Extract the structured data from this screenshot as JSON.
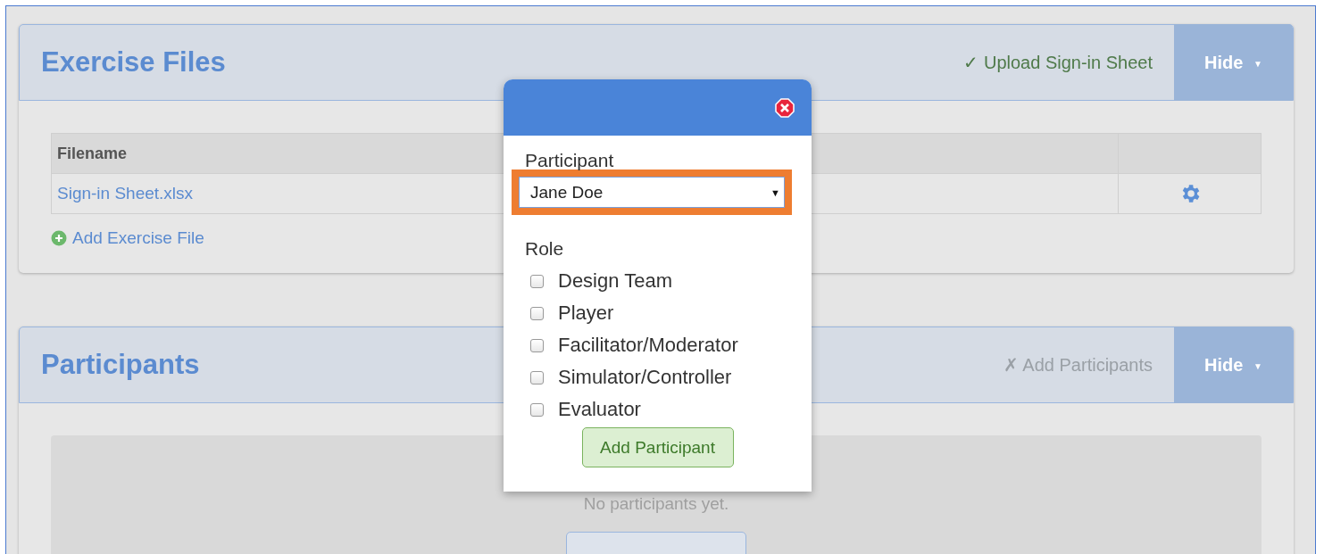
{
  "sections": [
    {
      "kind": "files",
      "title": "Exercise Files",
      "status": {
        "mark": "✓",
        "label": "Upload Sign-in Sheet",
        "done": true
      },
      "toggle": {
        "label": "Hide",
        "caret": "▼"
      },
      "table": {
        "columns": [
          "Filename"
        ],
        "rows": [
          {
            "filename": "Sign-in Sheet.xlsx"
          }
        ]
      },
      "add_link": "Add Exercise File"
    },
    {
      "kind": "empty",
      "title": "Participants",
      "status": {
        "mark": "✗",
        "label": "Add Participants",
        "done": false
      },
      "toggle": {
        "label": "Hide",
        "caret": "▼"
      },
      "empty_text": "No participants yet."
    }
  ],
  "dialog": {
    "participant_label": "Participant",
    "participant_value": "Jane Doe",
    "select_caret": "▼",
    "highlighted": true,
    "role_label": "Role",
    "roles": [
      {
        "label": "Design Team",
        "checked": false
      },
      {
        "label": "Player",
        "checked": false
      },
      {
        "label": "Facilitator/Moderator",
        "checked": false
      },
      {
        "label": "Simulator/Controller",
        "checked": false
      },
      {
        "label": "Evaluator",
        "checked": false
      }
    ],
    "submit": "Add Participant"
  }
}
